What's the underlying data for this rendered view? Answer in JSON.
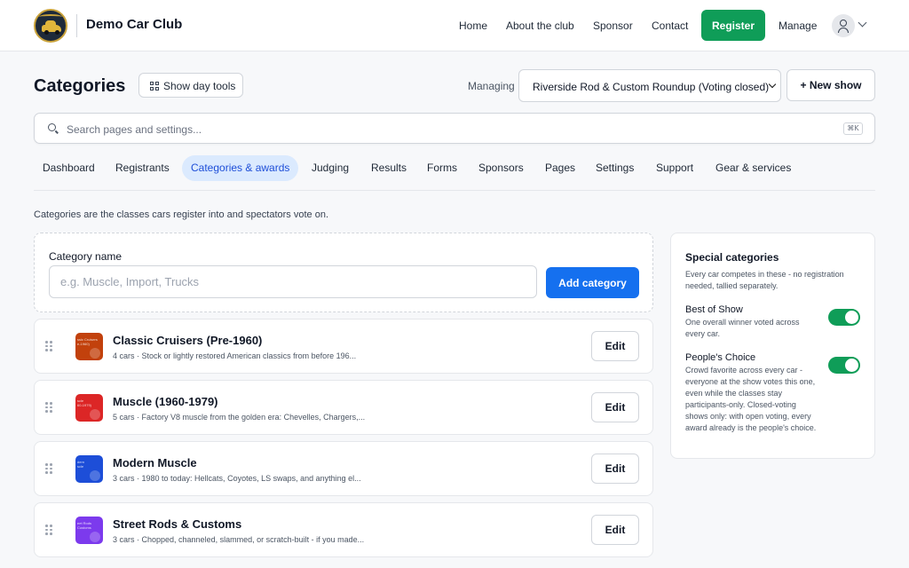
{
  "header": {
    "brand": "Demo Car Club",
    "nav": [
      {
        "label": "Home"
      },
      {
        "label": "About the club"
      },
      {
        "label": "Sponsor"
      },
      {
        "label": "Contact"
      }
    ],
    "register_label": "Register",
    "manage_label": "Manage"
  },
  "page": {
    "title": "Categories",
    "day_tools_label": "Show day tools",
    "managing_label": "Managing",
    "selected_show": "Riverside Rod & Custom Roundup (Voting closed)",
    "new_show_label": "+ New show"
  },
  "search": {
    "placeholder": "Search pages and settings...",
    "shortcut": "⌘K"
  },
  "tabs": [
    {
      "label": "Dashboard"
    },
    {
      "label": "Registrants"
    },
    {
      "label": "Categories & awards",
      "active": true
    },
    {
      "label": "Judging"
    },
    {
      "label": "Results"
    },
    {
      "label": "Forms"
    },
    {
      "label": "Sponsors"
    },
    {
      "label": "Pages"
    },
    {
      "label": "Settings"
    },
    {
      "label": "Support"
    },
    {
      "label": "Gear & services"
    }
  ],
  "intro": "Categories are the classes cars register into and spectators vote on.",
  "add_category": {
    "label": "Category name",
    "placeholder": "e.g. Muscle, Import, Trucks",
    "button_label": "Add category"
  },
  "categories": [
    {
      "name": "Classic Cruisers (Pre-1960)",
      "description": "4 cars · Stock or lightly restored American classics from before 196...",
      "thumb_text": "ssic Cruisers\ne-1960)",
      "color": "#c2410c",
      "edit_label": "Edit"
    },
    {
      "name": "Muscle (1960-1979)",
      "description": "5 cars · Factory V8 muscle from the golden era: Chevelles, Chargers,...",
      "thumb_text": "scle\n60-1979)",
      "color": "#dc2626",
      "edit_label": "Edit"
    },
    {
      "name": "Modern Muscle",
      "description": "3 cars · 1980 to today: Hellcats, Coyotes, LS swaps, and anything el...",
      "thumb_text": "dern\nscle",
      "color": "#1d4ed8",
      "edit_label": "Edit"
    },
    {
      "name": "Street Rods & Customs",
      "description": "3 cars · Chopped, channeled, slammed, or scratch-built - if you made...",
      "thumb_text": "eet Rods\nCustoms",
      "color": "#7c3aed",
      "edit_label": "Edit"
    }
  ],
  "special": {
    "title": "Special categories",
    "subtitle": "Every car competes in these - no registration needed, tallied separately.",
    "items": [
      {
        "name": "Best of Show",
        "description": "One overall winner voted across every car.",
        "enabled": true
      },
      {
        "name": "People's Choice",
        "description": "Crowd favorite across every car - everyone at the show votes this one, even while the classes stay participants-only. Closed-voting shows only: with open voting, every award already is the people's choice.",
        "enabled": true
      }
    ]
  },
  "colors": {
    "accent_green": "#0f9d58",
    "accent_blue": "#1570ef",
    "active_tab_bg": "#dbeafe",
    "active_tab_text": "#1d4ed8"
  }
}
